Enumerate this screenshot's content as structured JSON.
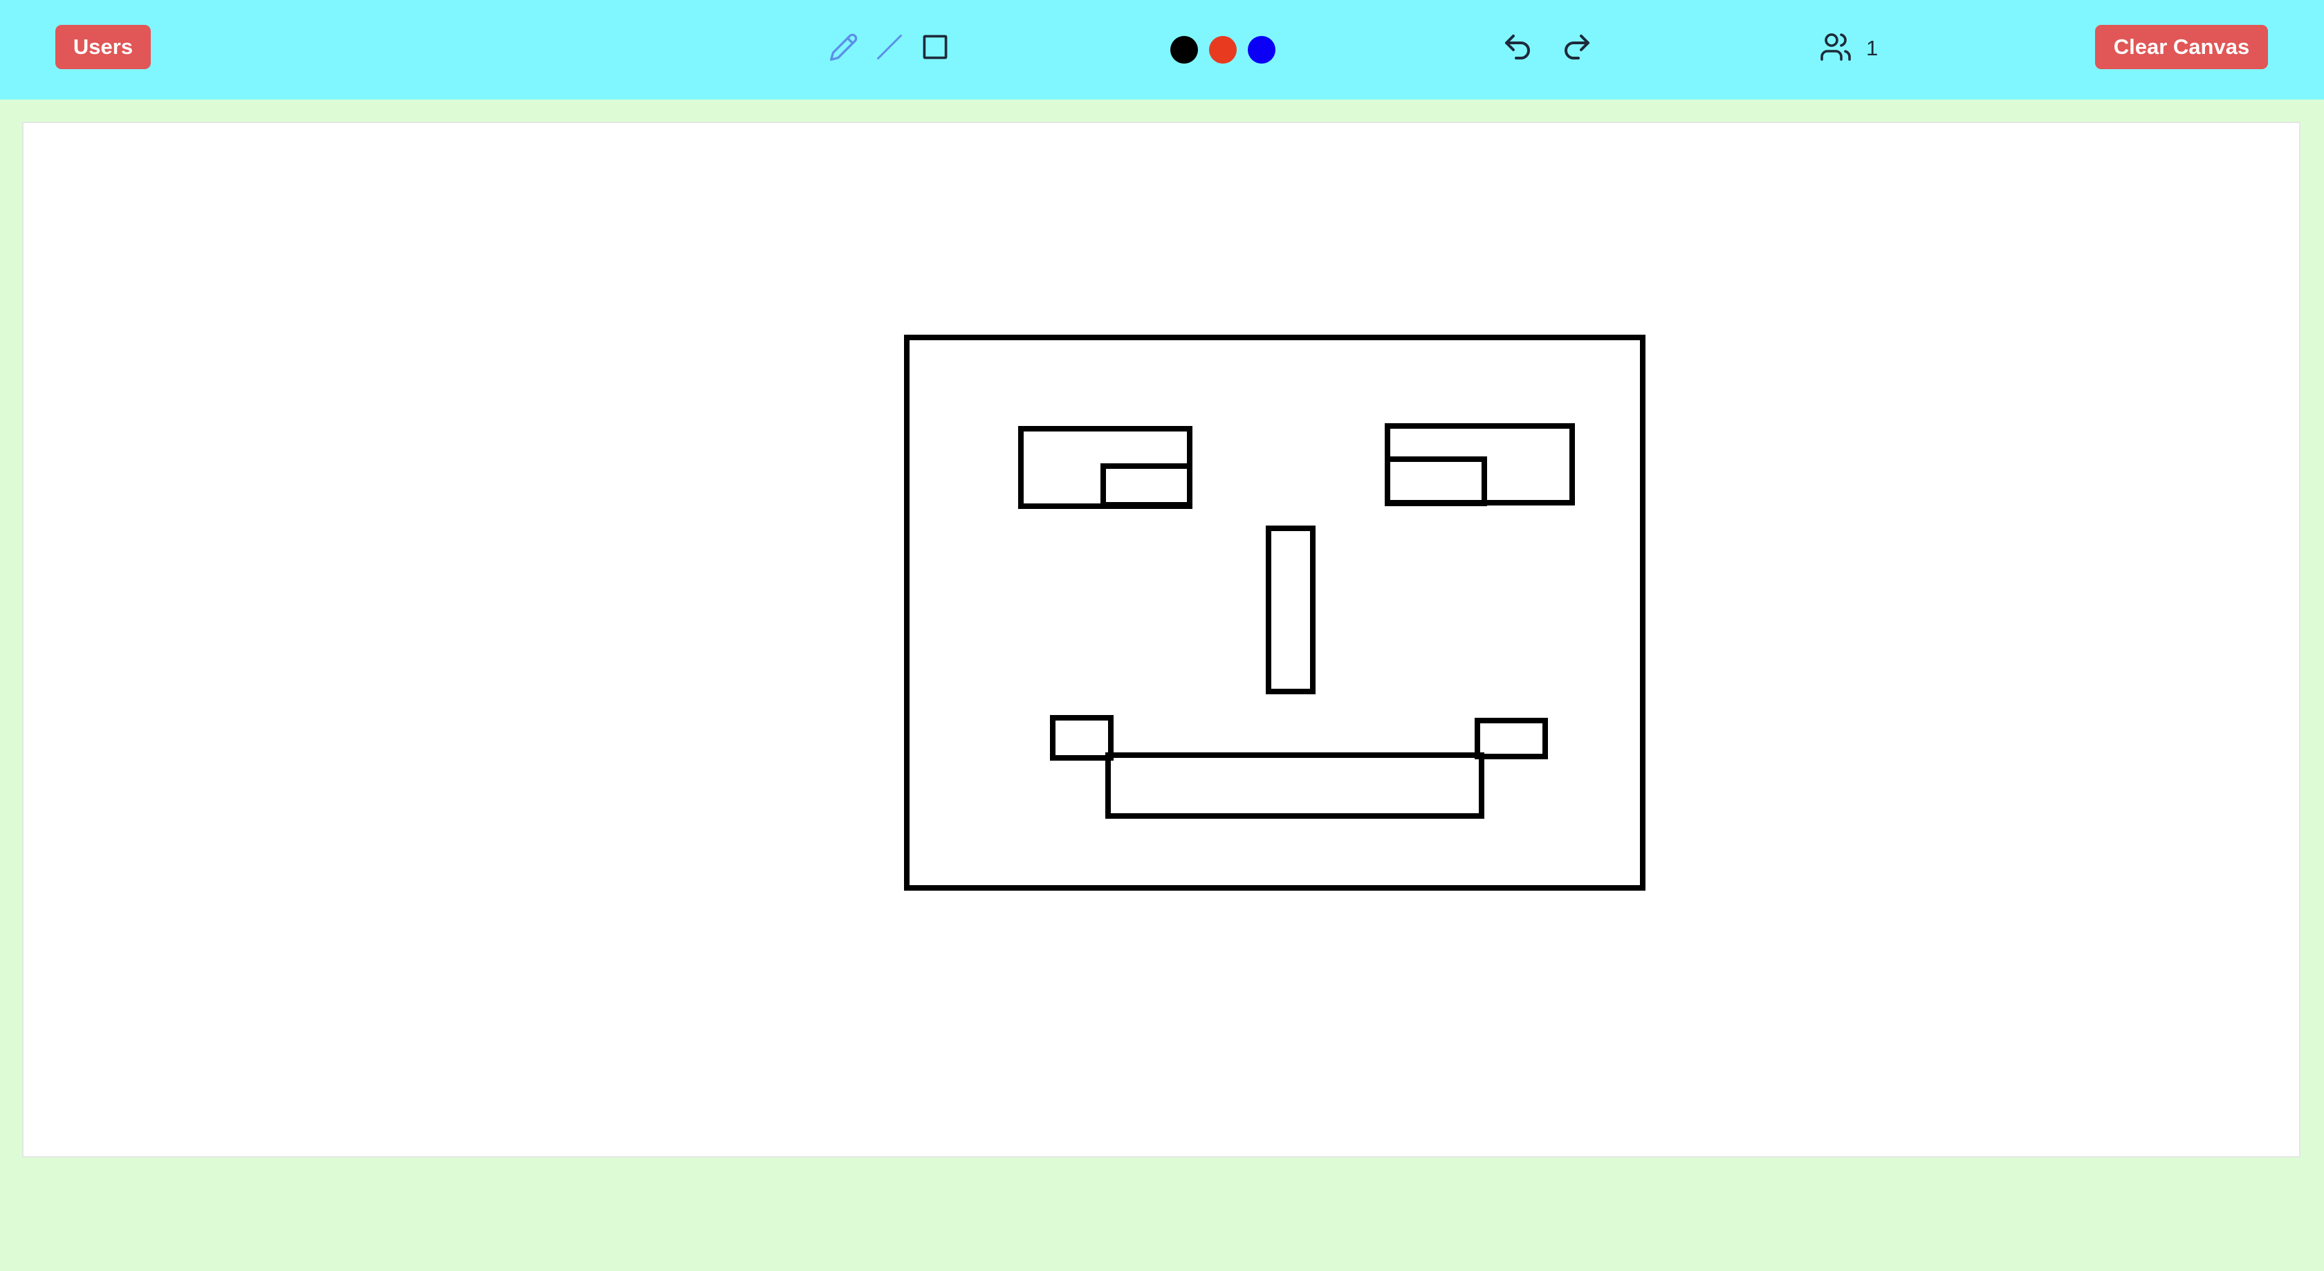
{
  "toolbar": {
    "users_label": "Users",
    "clear_label": "Clear Canvas",
    "tools": [
      {
        "name": "pencil-icon",
        "active": true
      },
      {
        "name": "line-icon",
        "active": false
      },
      {
        "name": "rectangle-icon",
        "active": false
      }
    ],
    "colors": [
      "#000000",
      "#e83a1f",
      "#0b00f5"
    ],
    "user_count": "1"
  },
  "theme": {
    "toolbar_bg": "#80f7ff",
    "page_bg": "#ddfcd5",
    "button_red": "#e15656",
    "active_tool": "#5b8fe8"
  }
}
